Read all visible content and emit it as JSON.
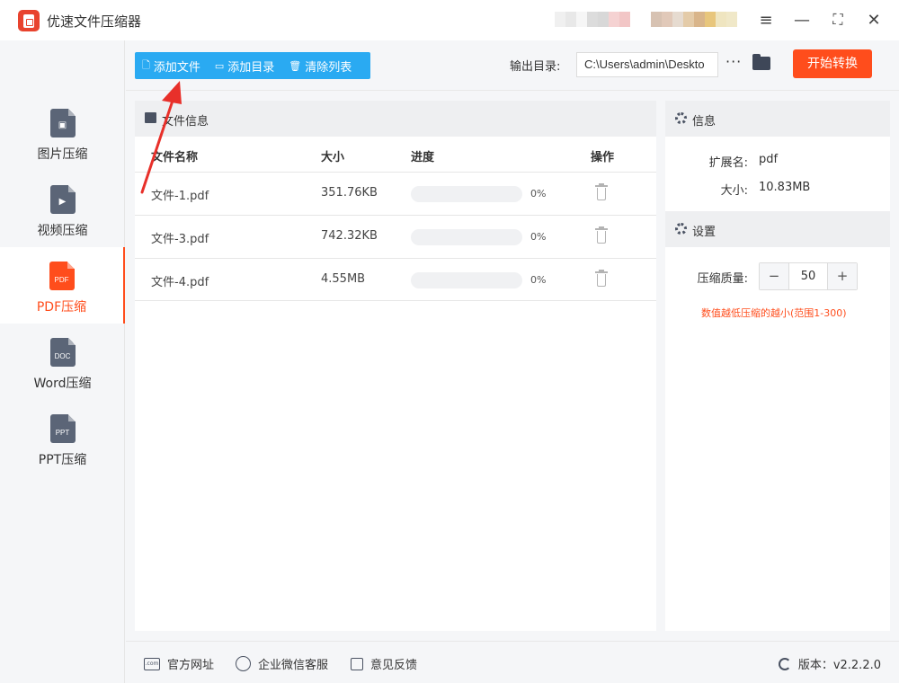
{
  "titlebar": {
    "app_title": "优速文件压缩器",
    "icons": [
      "app-logo-icon",
      "menu-icon",
      "minimize-icon",
      "maximize-icon",
      "close-icon"
    ]
  },
  "sidebar": {
    "items": [
      {
        "label": "图片压缩",
        "icon": "image-file-icon",
        "active": false
      },
      {
        "label": "视频压缩",
        "icon": "video-file-icon",
        "active": false
      },
      {
        "label": "PDF压缩",
        "icon": "pdf-file-icon",
        "tag": "PDF",
        "active": true
      },
      {
        "label": "Word压缩",
        "icon": "doc-file-icon",
        "tag": "DOC",
        "active": false
      },
      {
        "label": "PPT压缩",
        "icon": "ppt-file-icon",
        "tag": "PPT",
        "active": false
      }
    ]
  },
  "toolbar": {
    "add_file": "添加文件",
    "add_folder": "添加目录",
    "clear_list": "清除列表",
    "output_label": "输出目录:",
    "output_path": "C:\\Users\\admin\\Deskto",
    "more": "···",
    "start": "开始转换"
  },
  "file_panel": {
    "title": "文件信息",
    "columns": [
      "文件名称",
      "大小",
      "进度",
      "操作"
    ],
    "rows": [
      {
        "name": "文件-1.pdf",
        "size": "351.76KB",
        "progress": 0,
        "progress_text": "0%"
      },
      {
        "name": "文件-3.pdf",
        "size": "742.32KB",
        "progress": 0,
        "progress_text": "0%"
      },
      {
        "name": "文件-4.pdf",
        "size": "4.55MB",
        "progress": 0,
        "progress_text": "0%"
      }
    ]
  },
  "info_panel": {
    "title": "信息",
    "ext_label": "扩展名:",
    "ext_value": "pdf",
    "size_label": "大小:",
    "size_value": "10.83MB"
  },
  "settings_panel": {
    "title": "设置",
    "quality_label": "压缩质量:",
    "quality_value": "50",
    "minus": "−",
    "plus": "+",
    "hint": "数值越低压缩的越小(范围1-300)"
  },
  "footer": {
    "website": "官方网址",
    "wechat": "企业微信客服",
    "feedback": "意见反馈",
    "version": "版本：v2.2.2.0"
  },
  "colors": {
    "accent_orange": "#ff4d1c",
    "accent_blue": "#2aaaf2",
    "annotation_red": "#e8302a"
  }
}
